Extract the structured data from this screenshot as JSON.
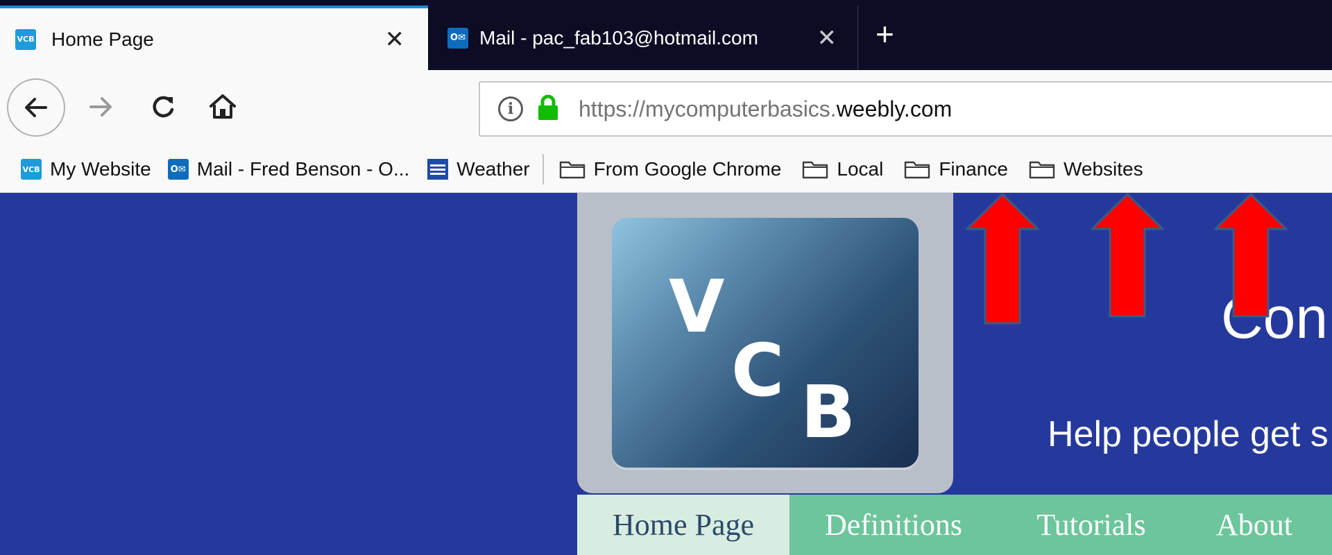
{
  "browser": {
    "tabs": [
      {
        "title": "Home Page",
        "icon": "vcb-favicon",
        "active": true
      },
      {
        "title": "Mail - pac_fab103@hotmail.com",
        "icon": "outlook-mail-icon",
        "active": false
      }
    ],
    "new_tab_label": "+",
    "close_glyph": "✕",
    "url_scheme": "https://mycomputerbasics.",
    "url_domain": "weebly.com",
    "bookmarks": [
      {
        "label": "My Website",
        "icon": "vcb-favicon"
      },
      {
        "label": "Mail - Fred Benson - O...",
        "icon": "outlook-mail-icon"
      },
      {
        "label": "Weather",
        "icon": "weather-channel-icon"
      },
      {
        "label": "From Google Chrome",
        "icon": "folder-icon"
      },
      {
        "label": "Local",
        "icon": "folder-icon"
      },
      {
        "label": "Finance",
        "icon": "folder-icon"
      },
      {
        "label": "Websites",
        "icon": "folder-icon"
      }
    ],
    "favicon_vcb_text": "VCB",
    "favicon_mail_text": "O✉"
  },
  "site": {
    "logo_letters": [
      "V",
      "C",
      "B"
    ],
    "title": "Con",
    "tagline": "Help people get s",
    "nav": [
      {
        "label": "Home Page",
        "active": true
      },
      {
        "label": "Definitions",
        "active": false
      },
      {
        "label": "Tutorials",
        "active": false
      },
      {
        "label": "About",
        "active": false
      }
    ]
  },
  "colors": {
    "page_background": "#25399c",
    "nav_green": "#6cc59b",
    "nav_active": "#d8ece1",
    "annotation_arrow": "#ff0000",
    "tab_highlight": "#1e88e5"
  }
}
